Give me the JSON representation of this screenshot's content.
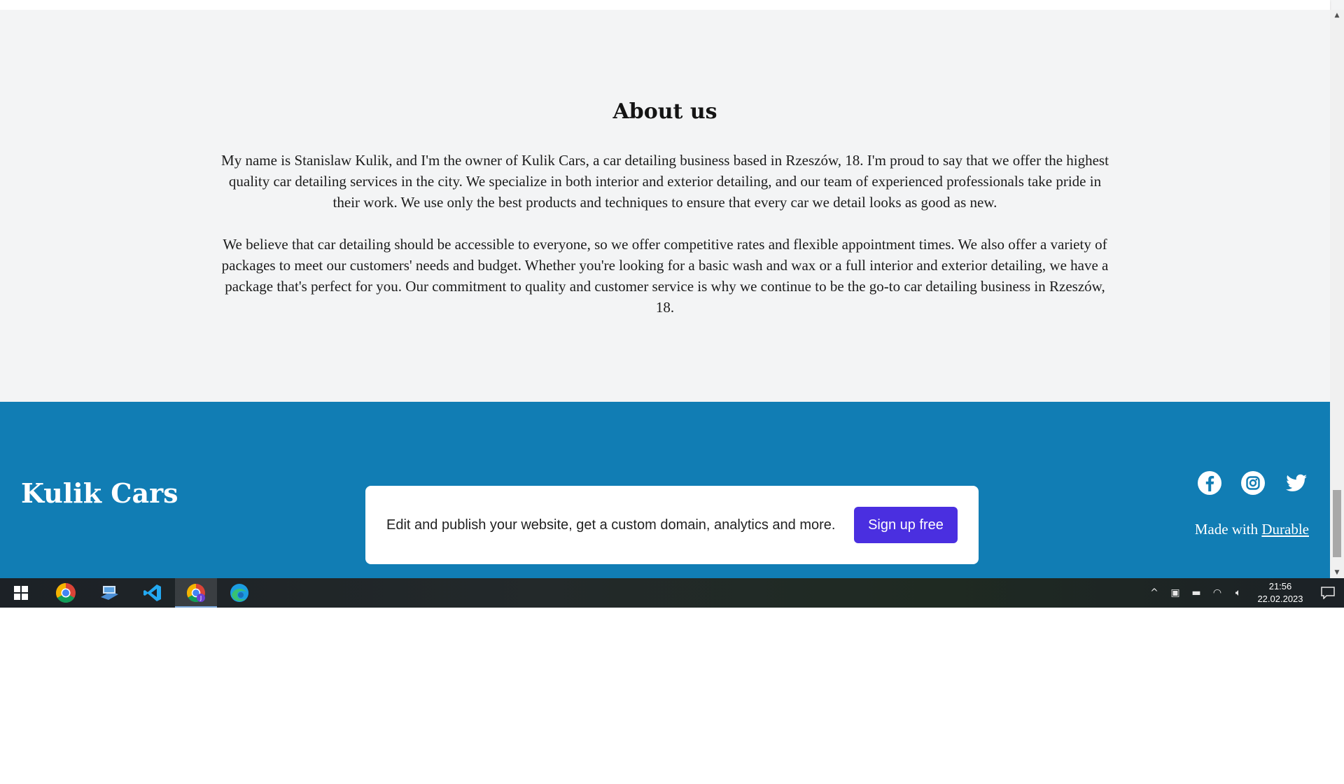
{
  "about": {
    "title": "About us",
    "paragraph1": "My name is Stanislaw Kulik, and I'm the owner of Kulik Cars, a car detailing business based in Rzeszów, 18. I'm proud to say that we offer the highest quality car detailing services in the city. We specialize in both interior and exterior detailing, and our team of experienced professionals take pride in their work. We use only the best products and techniques to ensure that every car we detail looks as good as new.",
    "paragraph2": "We believe that car detailing should be accessible to everyone, so we offer competitive rates and flexible appointment times. We also offer a variety of packages to meet our customers' needs and budget. Whether you're looking for a basic wash and wax or a full interior and exterior detailing, we have a package that's perfect for you. Our commitment to quality and customer service is why we continue to be the go-to car detailing business in Rzeszów, 18."
  },
  "footer": {
    "brand": "Kulik Cars",
    "promo_text": "Edit and publish your website, get a custom domain, analytics and more.",
    "signup_label": "Sign up free",
    "made_with_prefix": "Made with",
    "made_with_link": "Durable",
    "social": [
      "facebook-icon",
      "instagram-icon",
      "twitter-icon"
    ]
  },
  "taskbar": {
    "apps": [
      "windows-start-icon",
      "chrome-icon",
      "file-explorer-icon",
      "vscode-icon",
      "chrome-profile-icon",
      "edge-icon"
    ],
    "time": "21:56",
    "date": "22.02.2023"
  },
  "colors": {
    "footer_bg": "#117db4",
    "signup_bg": "#4a2fe0",
    "page_bg": "#f3f4f5"
  }
}
